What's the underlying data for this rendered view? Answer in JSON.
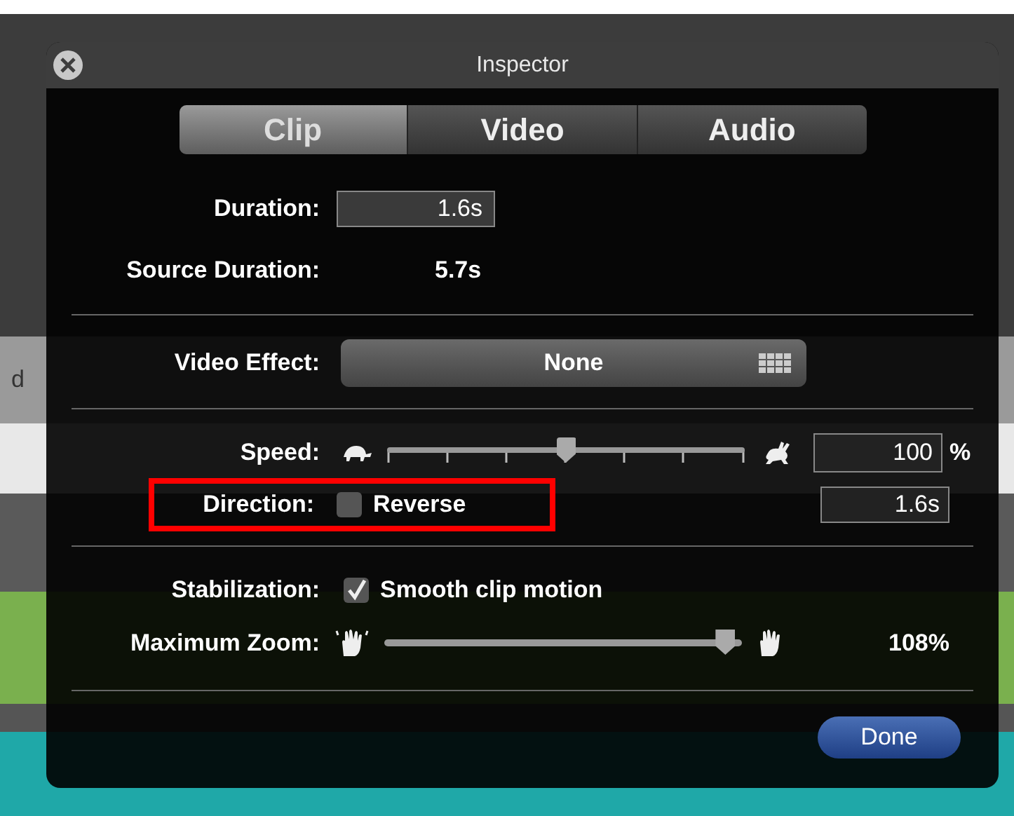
{
  "background_app": {
    "status_text": "d"
  },
  "window": {
    "title": "Inspector"
  },
  "tabs": [
    {
      "label": "Clip",
      "selected": true
    },
    {
      "label": "Video",
      "selected": false
    },
    {
      "label": "Audio",
      "selected": false
    }
  ],
  "duration": {
    "label": "Duration:",
    "value": "1.6s"
  },
  "source_duration": {
    "label": "Source Duration:",
    "value": "5.7s"
  },
  "video_effect": {
    "label": "Video Effect:",
    "value": "None"
  },
  "speed": {
    "label": "Speed:",
    "level": 0.5,
    "value": "100",
    "unit": "%"
  },
  "direction": {
    "label": "Direction:",
    "option": "Reverse",
    "checked": false,
    "highlighted": true,
    "duration": "1.6s"
  },
  "stabilization": {
    "label": "Stabilization:",
    "option": "Smooth clip motion",
    "checked": true
  },
  "maximum_zoom": {
    "label": "Maximum Zoom:",
    "level": 0.98,
    "value": "108%"
  },
  "buttons": [
    {
      "label": "Done"
    }
  ]
}
